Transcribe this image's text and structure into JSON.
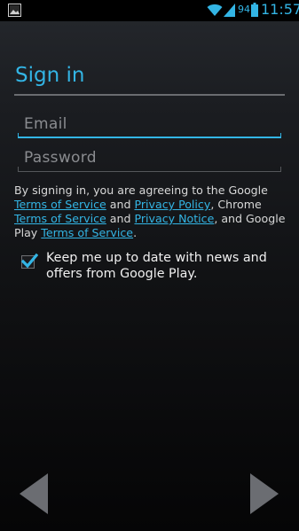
{
  "status_bar": {
    "battery_level": "94",
    "time": "11:57",
    "accent_color": "#33b5e5",
    "icons": [
      "image-notification-icon",
      "wifi-icon",
      "cell-signal-icon",
      "battery-icon"
    ]
  },
  "header": {
    "title": "Sign in"
  },
  "form": {
    "email_placeholder": "Email",
    "email_value": "",
    "password_placeholder": "Password",
    "password_value": ""
  },
  "terms": {
    "text_1": "By signing in, you are agreeing to the Google ",
    "link_1": "Terms of Service",
    "text_2": " and ",
    "link_2": "Privacy Policy",
    "text_3": ", Chrome ",
    "link_3": "Terms of Service",
    "text_4": " and ",
    "link_4": "Privacy Notice",
    "text_5": ", and Google Play ",
    "link_5": "Terms of Service",
    "text_6": "."
  },
  "opt_in": {
    "checked": true,
    "label": "Keep me up to date with news and offers from Google Play."
  },
  "navigation": {
    "back_icon": "left-triangle-icon",
    "next_icon": "right-triangle-icon"
  }
}
